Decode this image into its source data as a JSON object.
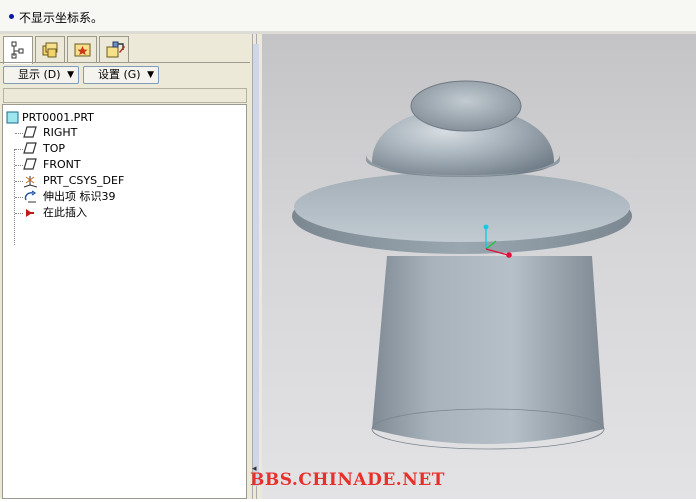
{
  "message_bar": {
    "text": "不显示坐标系。"
  },
  "navigator": {
    "tabs": [
      {
        "icon": "model-tree-icon",
        "active": true
      },
      {
        "icon": "folder-browser-icon",
        "active": false
      },
      {
        "icon": "favorites-icon",
        "active": false
      },
      {
        "icon": "connections-icon",
        "active": false
      }
    ],
    "toolbar": {
      "show_label": "显示 (D)",
      "settings_label": "设置 (G)"
    },
    "tree": {
      "root": "PRT0001.PRT",
      "items": [
        {
          "label": "RIGHT",
          "icon": "datum-plane-icon"
        },
        {
          "label": "TOP",
          "icon": "datum-plane-icon"
        },
        {
          "label": "FRONT",
          "icon": "datum-plane-icon"
        },
        {
          "label": "PRT_CSYS_DEF",
          "icon": "coordinate-system-icon"
        },
        {
          "label": "伸出项 标识39",
          "icon": "revolve-feature-icon"
        },
        {
          "label": "在此插入",
          "icon": "insert-here-arrow-icon"
        }
      ]
    }
  },
  "viewport": {
    "model": "revolved part: dome with brim on tapered cylinder",
    "watermark": "BBS.CHINADE.NET"
  },
  "colors": {
    "model_shade": "#a8b2ba",
    "insert_arrow": "#c0161c",
    "watermark": "#e8302a",
    "csys_x": "#e0103a",
    "csys_y": "#19c83a",
    "csys_z": "#18c8e8"
  }
}
